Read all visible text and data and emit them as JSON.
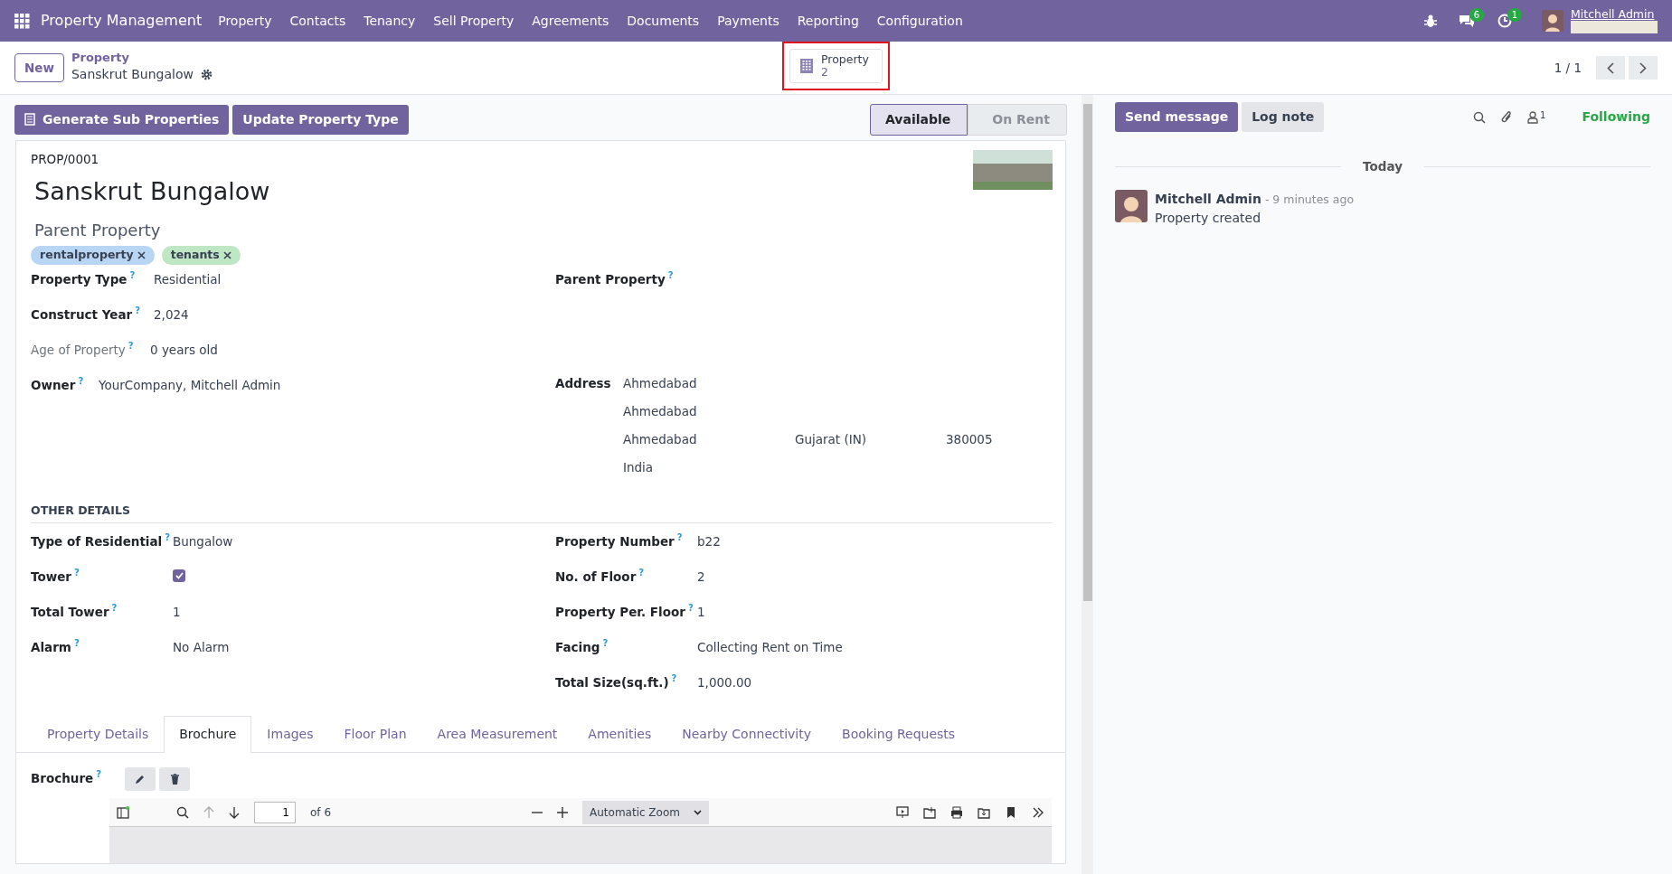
{
  "navbar": {
    "app_name": "Property Management",
    "menu": [
      "Property",
      "Contacts",
      "Tenancy",
      "Sell Property",
      "Agreements",
      "Documents",
      "Payments",
      "Reporting",
      "Configuration"
    ],
    "messages_count": "6",
    "activities_count": "1",
    "user_name": "Mitchell Admin"
  },
  "control_panel": {
    "new_button": "New",
    "breadcrumb_parent": "Property",
    "breadcrumb_current": "Sanskrut Bungalow",
    "smart_button": {
      "label": "Property",
      "value": "2"
    },
    "pager": "1 / 1"
  },
  "header_buttons": [
    "Generate Sub Properties",
    "Update Property Type"
  ],
  "status_bar": [
    {
      "label": "Available",
      "selected": true
    },
    {
      "label": "On Rent",
      "selected": false
    }
  ],
  "form": {
    "reference": "PROP/0001",
    "name": "Sanskrut Bungalow",
    "parent_heading": "Parent Property",
    "tags": [
      {
        "label": "rentalproperty",
        "color": "#b9d5f4"
      },
      {
        "label": "tenants",
        "color": "#bfe7c4"
      }
    ],
    "left_fields": [
      {
        "label": "Property Type",
        "help": "?",
        "value": "Residential",
        "muted": false
      },
      {
        "label": "Construct Year",
        "help": "?",
        "value": "2,024",
        "muted": false
      },
      {
        "label": "Age of Property",
        "help": "?",
        "value": "0 years old",
        "muted": true
      },
      {
        "label": "Owner",
        "help": "?",
        "value": "YourCompany, Mitchell Admin",
        "muted": false
      }
    ],
    "parent_property": {
      "label": "Parent Property",
      "help": "?"
    },
    "address": {
      "label": "Address",
      "lines": [
        [
          "Ahmedabad"
        ],
        [
          "Ahmedabad"
        ],
        [
          "Ahmedabad",
          "Gujarat (IN)",
          "380005"
        ],
        [
          "India"
        ]
      ]
    },
    "other_details_heading": "OTHER DETAILS",
    "other_left": [
      {
        "label": "Type of Residential",
        "help": "?",
        "kind": "text",
        "value": "Bungalow"
      },
      {
        "label": "Tower",
        "help": "?",
        "kind": "checkbox",
        "checked": true
      },
      {
        "label": "Total Tower",
        "help": "?",
        "kind": "text",
        "value": "1"
      },
      {
        "label": "Alarm",
        "help": "?",
        "kind": "text",
        "value": "No Alarm"
      }
    ],
    "other_right": [
      {
        "label": "Property Number",
        "help": "?",
        "value": "b22"
      },
      {
        "label": "No. of Floor",
        "help": "?",
        "value": "2"
      },
      {
        "label": "Property Per. Floor",
        "help": "?",
        "value": "1"
      },
      {
        "label": "Facing",
        "help": "?",
        "value": "Collecting Rent on Time"
      },
      {
        "label": "Total Size(sq.ft.)",
        "help": "?",
        "value": "1,000.00"
      }
    ],
    "tabs": [
      {
        "label": "Property Details",
        "selected": false
      },
      {
        "label": "Brochure",
        "selected": true
      },
      {
        "label": "Images",
        "selected": false
      },
      {
        "label": "Floor Plan",
        "selected": false
      },
      {
        "label": "Area Measurement",
        "selected": false
      },
      {
        "label": "Amenities",
        "selected": false
      },
      {
        "label": "Nearby Connectivity",
        "selected": false
      },
      {
        "label": "Booking Requests",
        "selected": false
      }
    ],
    "brochure": {
      "label": "Brochure",
      "help": "?",
      "page_number": "1",
      "page_total": "of 6",
      "zoom": "Automatic Zoom"
    }
  },
  "chatter": {
    "buttons": [
      "Send message",
      "Log note"
    ],
    "followers_count": "1",
    "following": "Following",
    "date_separator": "Today",
    "messages": [
      {
        "author": "Mitchell Admin",
        "time": "- 9 minutes ago",
        "body": "Property created"
      }
    ]
  }
}
